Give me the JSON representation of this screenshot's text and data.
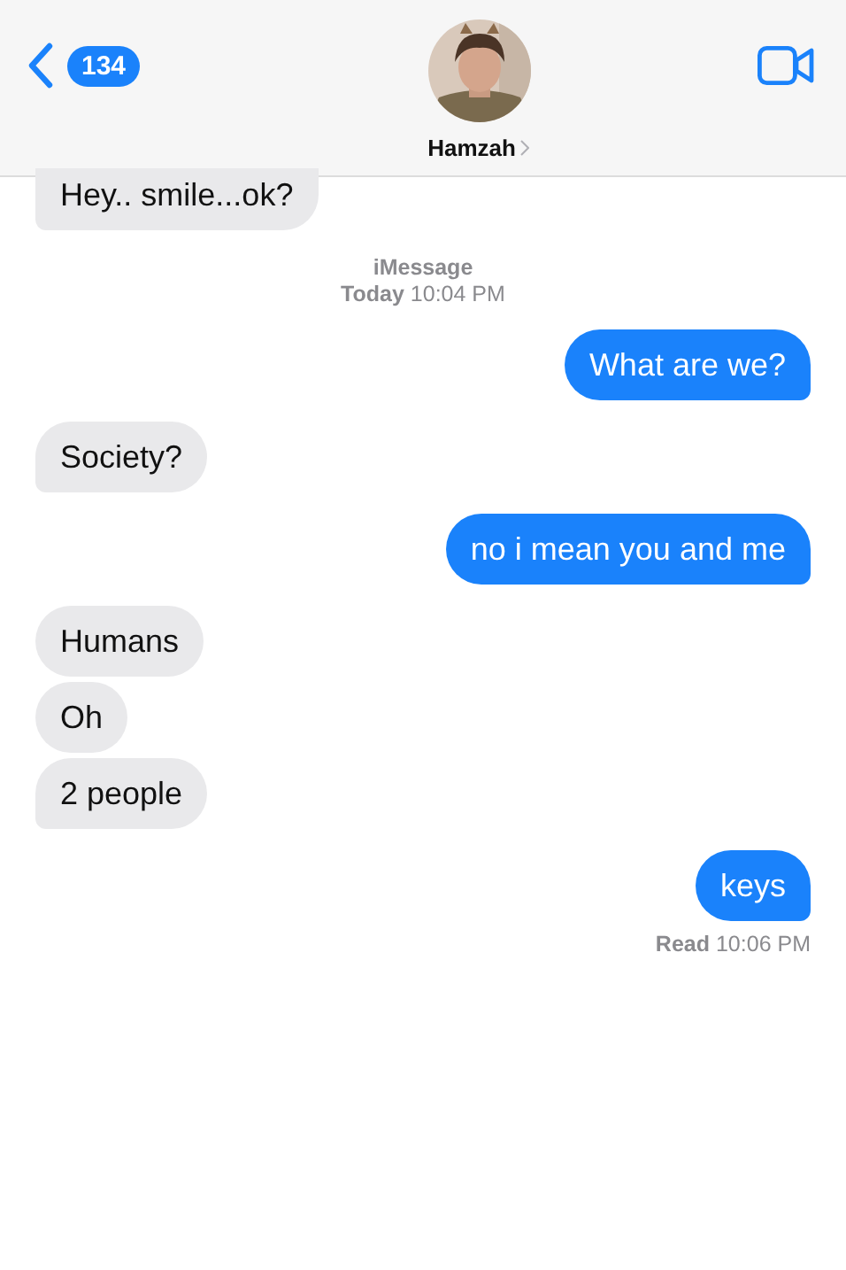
{
  "header": {
    "back_count": "134",
    "contact_name": "Hamzah"
  },
  "messages": [
    {
      "kind": "received",
      "text": "Hey.. smile...ok?",
      "tail": true
    },
    {
      "kind": "timestamp",
      "service": "iMessage",
      "day": "Today",
      "time": "10:04 PM"
    },
    {
      "kind": "sent",
      "text": "What are we?",
      "tail": true
    },
    {
      "kind": "received",
      "text": "Society?",
      "tail": true
    },
    {
      "kind": "sent",
      "text": "no i mean you and me",
      "tail": true
    },
    {
      "kind": "received",
      "text": "Humans",
      "tail": false
    },
    {
      "kind": "received",
      "text": "Oh",
      "tail": false
    },
    {
      "kind": "received",
      "text": "2 people",
      "tail": true
    },
    {
      "kind": "sent",
      "text": "keys",
      "tail": true
    }
  ],
  "receipt": {
    "status": "Read",
    "time": "10:06 PM"
  }
}
